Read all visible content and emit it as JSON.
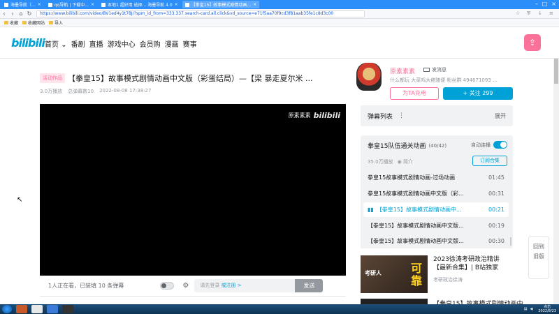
{
  "browser": {
    "tabs": [
      {
        "label": "海墨导航（...",
        "active": false
      },
      {
        "label": "qq导航 | 下载中...",
        "active": false
      },
      {
        "label": "本地1 超好用 选择... 海墨导航 4.0",
        "active": false
      },
      {
        "label": "【拳皇15】故事模式剧情动画...",
        "active": true
      }
    ],
    "url": "https://www.bilibili.com/video/BV1ed4y1t78J/?spm_id_from=333.337.search-card.all.click&vd_source=e71f5aa70f9cd3f81aab35fe1c8d3c00",
    "bookmarks": [
      "收藏",
      "收藏网站",
      "导入"
    ]
  },
  "header": {
    "logo": "bilibili",
    "nav": [
      "首页",
      "番剧",
      "直播",
      "游戏中心",
      "会员购",
      "漫画",
      "赛事"
    ],
    "upload_icon": "upload-icon"
  },
  "video": {
    "tag": "活动作品",
    "title": "【拳皇15】故事模式剧情动画中文版（彩蛋结局）—【梁 暴走夏尔米 ...",
    "views": "3.0万播放",
    "danmaku_count": "总弹幕数10",
    "date": "2022-08-08 17:38:27",
    "watermark_name": "原素素素",
    "watermark_logo": "bilibili"
  },
  "sendbar": {
    "viewers": "1人正在看，已装填 10 条弹幕",
    "placeholder": "请先登录",
    "link": "或注册 >",
    "send": "发送"
  },
  "uploader": {
    "name": "原素素素",
    "message": "发消息",
    "desc": "什么都玩 大菜鸡大佬随便 粉丝群 494671093 ...",
    "charge": "为TA充电",
    "follow": "+ 关注 299"
  },
  "danmaku_list": {
    "title": "弹幕列表",
    "expand": "展开"
  },
  "playlist": {
    "title": "拳皇15队伍通关动画",
    "count": "(40/42)",
    "autoplay": "自动连播",
    "plays": "35.0万播放",
    "intro": "简介",
    "subscribe": "订阅合集",
    "items": [
      {
        "title": "拳皇15故事模式剧情动画-过场动画",
        "duration": "01:45",
        "current": false
      },
      {
        "title": "拳皇15故事模式剧情动画中文版（彩...",
        "duration": "00:31",
        "current": false
      },
      {
        "title": "【拳皇15】故事模式剧情动画中...",
        "duration": "00:21",
        "current": true
      },
      {
        "title": "【拳皇15】故事模式剧情动画中文版...",
        "duration": "00:19",
        "current": false
      },
      {
        "title": "【拳皇15】故事模式剧情动画中文版...",
        "duration": "00:30",
        "current": false
      }
    ]
  },
  "recommend": [
    {
      "title": "2023徐涛考研政治精讲【最新合集】| B站独家",
      "author": "考研政治徐涛",
      "thumb_text": "考研人",
      "thumb_badge": "可靠"
    },
    {
      "title": "【拳皇15】故事模式剧情动画中...",
      "author": "",
      "thumb_text": "",
      "thumb_badge": ""
    }
  ],
  "float_btn": {
    "line1": "回到",
    "line2": "旧版"
  },
  "taskbar": {
    "time": "点击",
    "date": "2022/8/23"
  }
}
